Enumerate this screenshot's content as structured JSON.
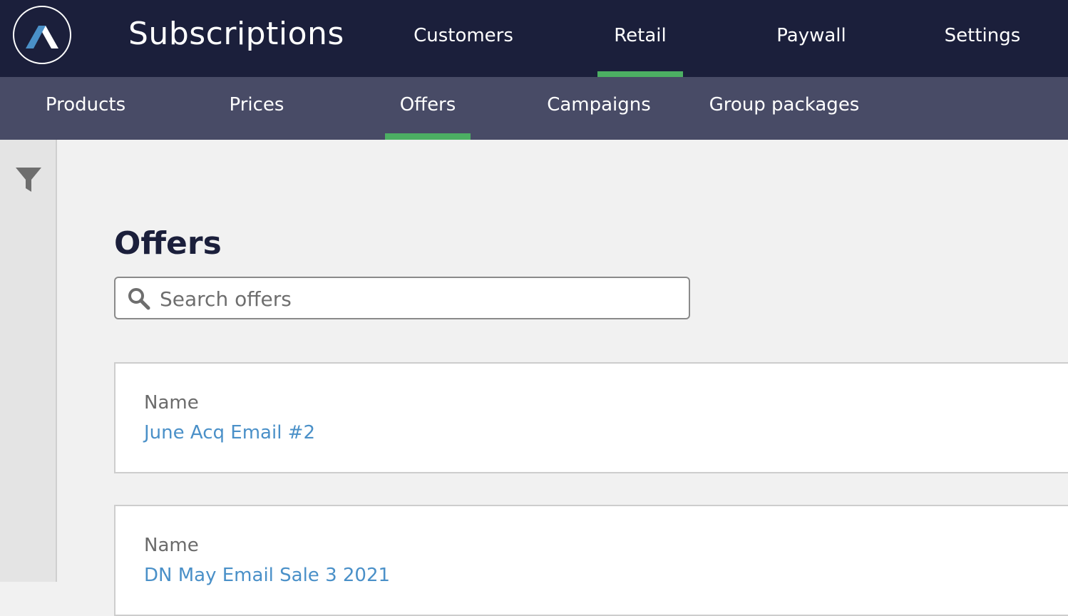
{
  "app": {
    "title": "Subscriptions"
  },
  "main_nav": [
    {
      "label": "Customers",
      "active": false
    },
    {
      "label": "Retail",
      "active": true
    },
    {
      "label": "Paywall",
      "active": false
    },
    {
      "label": "Settings",
      "active": false
    }
  ],
  "sub_nav": [
    {
      "label": "Products",
      "active": false
    },
    {
      "label": "Prices",
      "active": false
    },
    {
      "label": "Offers",
      "active": true
    },
    {
      "label": "Campaigns",
      "active": false
    },
    {
      "label": "Group packages",
      "active": false
    }
  ],
  "page": {
    "title": "Offers",
    "search": {
      "placeholder": "Search offers",
      "value": ""
    }
  },
  "offers": [
    {
      "label": "Name",
      "name": "June Acq Email #2"
    },
    {
      "label": "Name",
      "name": "DN May Email Sale 3 2021"
    }
  ],
  "colors": {
    "topbar": "#1b1f3b",
    "subbar": "#484b66",
    "accent": "#4caf63",
    "link": "#4a90c8"
  },
  "icons": {
    "logo": "brand-logo",
    "filter": "filter-icon",
    "search": "search-icon"
  }
}
